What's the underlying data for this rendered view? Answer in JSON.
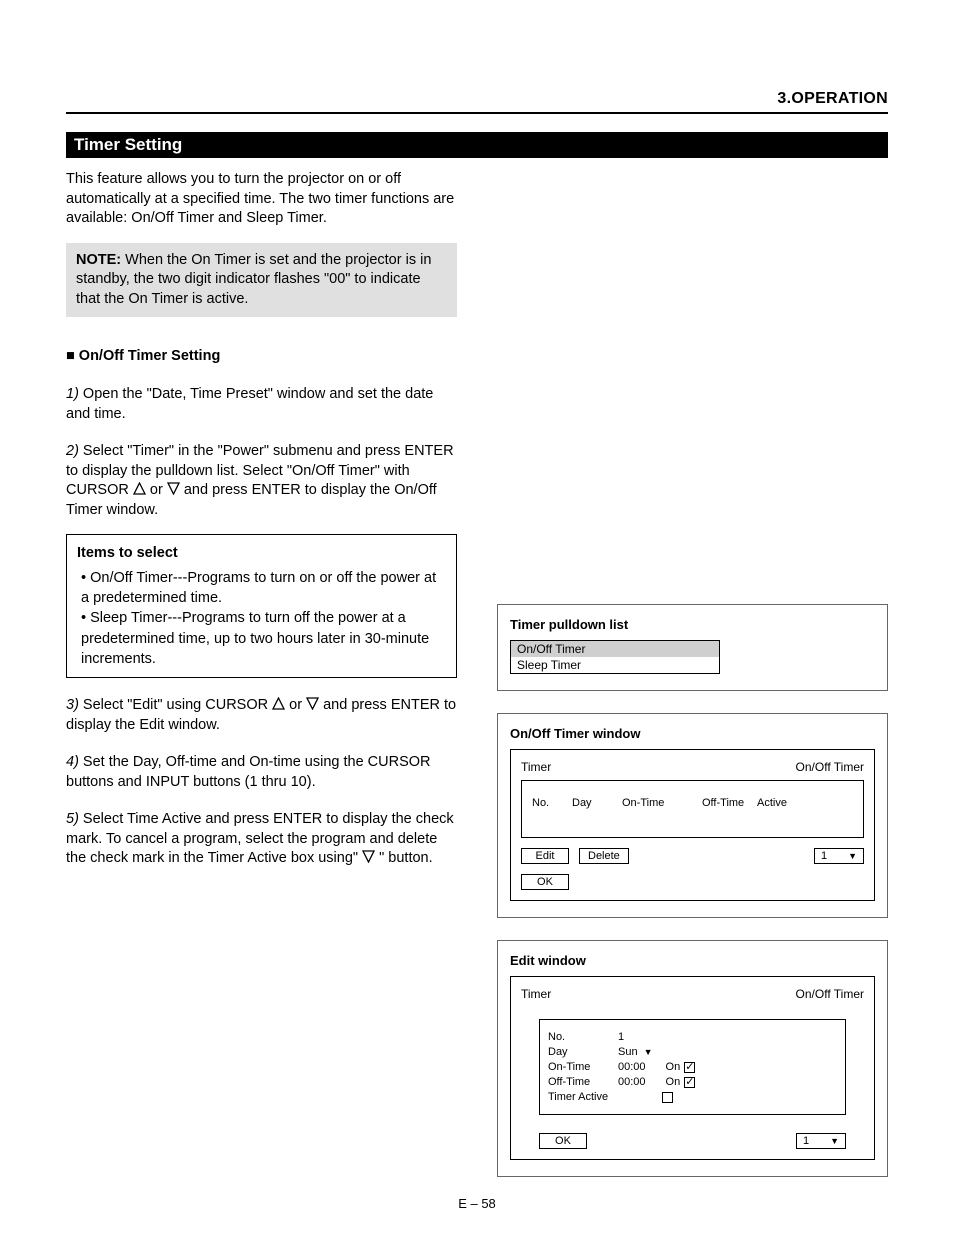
{
  "chapter": "3.OPERATION",
  "title": "Timer Setting",
  "intro": "This feature allows you to turn the projector on or off automatically at a specified time. The two timer functions are available: On/Off Timer and Sleep Timer.",
  "note_label": "NOTE:",
  "note": " When the On Timer is set and the projector is in standby, the two digit indicator flashes \"00\" to indicate that the On Timer is active.",
  "steps_heading": "■ On/Off Timer Setting",
  "step1": "Open the \"Date, Time Preset\" window and set the date and time.",
  "step2_prefix": "Select \"Timer\" in the \"Power\" submenu and press ENTER to display the pulldown list. Select \"On/Off Timer\" with CURSOR ",
  "step2_suffix": " and press ENTER to display the On/Off Timer window.",
  "items": {
    "heading": "Items to select",
    "b1": "• On/Off Timer---Programs to turn on or off the power at a predetermined time.",
    "b2": "• Sleep Timer---Programs to turn off the power at a predetermined time, up to two hours later in 30-minute increments."
  },
  "step3_prefix": "Select \"Edit\" using CURSOR ",
  "step3_suffix": " and press ENTER to display the Edit window.",
  "step4": "Set the Day, Off-time and On-time using the CURSOR buttons and INPUT buttons (1 thru 10).",
  "step5_prefix": "Select Time Active and press ENTER to display the check mark. To cancel a program, select the program and delete the check mark in the Timer Active box using\"",
  "step5_mid": "\" button.",
  "right": {
    "pulldown_title": "Timer pulldown list",
    "pulldown_items": [
      "On/Off Timer",
      "Sleep Timer"
    ],
    "onoff_win_title": "On/Off Timer window",
    "menu_left": "Timer",
    "menu_right": "On/Off Timer",
    "list_header": [
      "No.",
      "Day",
      "On-Time",
      "Off-Time",
      "Active"
    ],
    "btn_edit": "Edit",
    "btn_delete": "Delete",
    "btn_ok": "OK",
    "dd_label": "1",
    "edit_win_label": "Edit window",
    "edit_rows": {
      "no": "No.",
      "day": "Day",
      "on": "On-Time",
      "off": "Off-Time",
      "active": "Timer Active"
    },
    "edit_vals": {
      "no": "1",
      "day": "Sun",
      "on": "00:00",
      "off": "00:00",
      "onchk": "On",
      "offchk": "On"
    }
  },
  "pagenum": "E – 58"
}
